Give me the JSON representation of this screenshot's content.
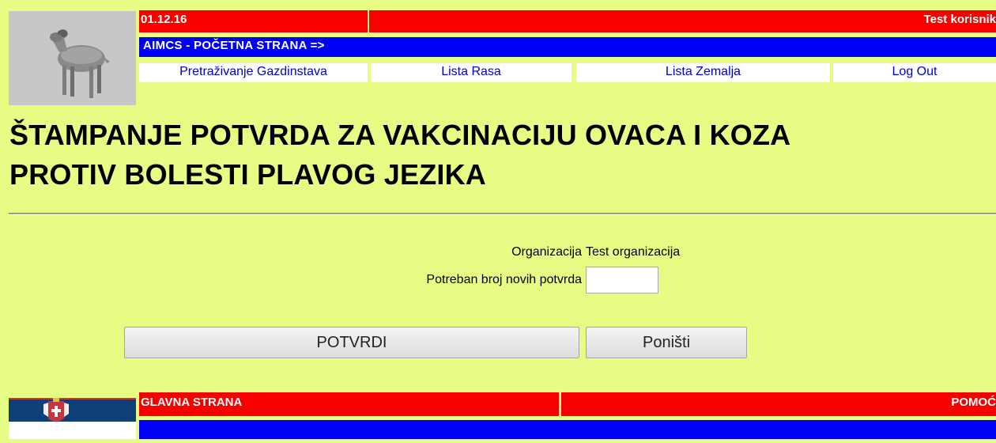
{
  "header": {
    "date": "01.12.16",
    "user": "Test korisnik",
    "home_link": "AIMCS - POČETNA STRANA =>",
    "nav": [
      "Pretraživanje Gazdinstava",
      "Lista Rasa",
      "Lista Zemalja",
      "Log Out"
    ]
  },
  "page": {
    "title_line1": "ŠTAMPANJE POTVRDA ZA VAKCINACIJU OVACA I KOZA",
    "title_line2": "PROTIV BOLESTI PLAVOG JEZIKA"
  },
  "form": {
    "org_label": "Organizacija",
    "org_value": "Test organizacija",
    "qty_label": "Potreban broj novih potvrda",
    "qty_value": "",
    "confirm_label": "POTVRDI",
    "cancel_label": "Poništi"
  },
  "footer": {
    "main_page": "GLAVNA STRANA",
    "help": "POMOĆ"
  },
  "colors": {
    "background": "#e6fc84",
    "red_bar": "#f60000",
    "blue_bar": "#0000f6",
    "nav_link": "#0000cc"
  },
  "icons": {
    "logo": "ram-logo",
    "flag": "serbia-flag"
  }
}
